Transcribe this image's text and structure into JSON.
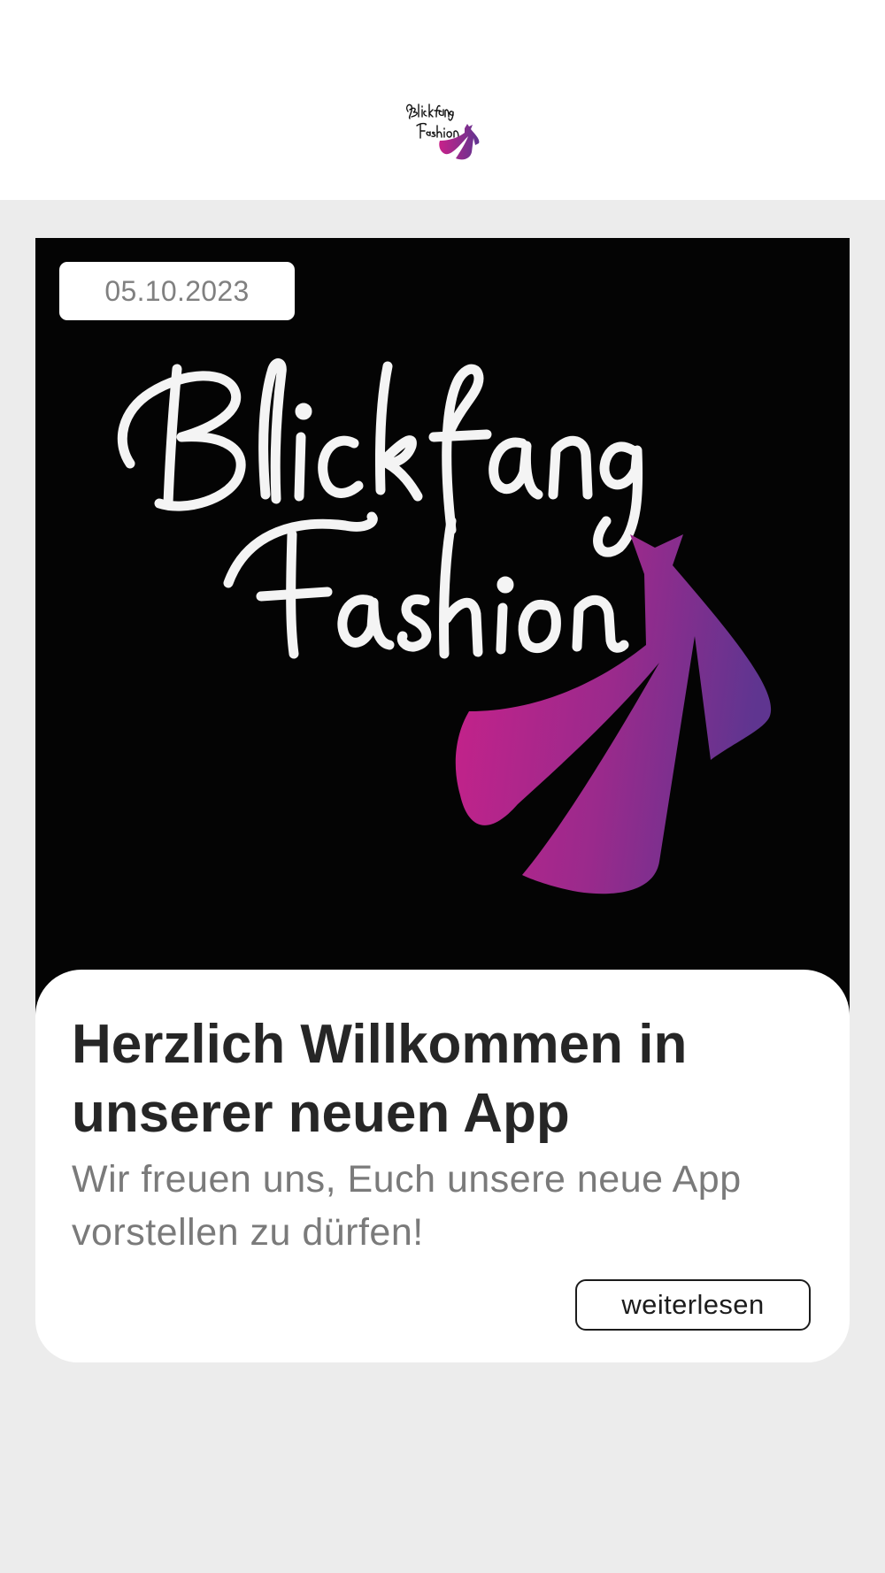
{
  "header": {
    "logo_text": "Blickfang Fashion",
    "logo_icon": "dress-icon"
  },
  "news_card": {
    "date": "05.10.2023",
    "image": {
      "logo_text": "Blickfang Fashion",
      "icon": "dress-icon",
      "background_color": "#040404",
      "gradient_start": "#c8218a",
      "gradient_end": "#5f3590"
    },
    "title": "Herzlich Willkommen in unserer neuen App",
    "teaser": "Wir freuen uns, Euch unsere neue App vorstellen zu dürfen!",
    "read_more_label": "weiterlesen"
  },
  "colors": {
    "page_background": "#ececec",
    "header_background": "#ffffff",
    "title_text": "#262626",
    "body_text": "#7a7a7a"
  }
}
